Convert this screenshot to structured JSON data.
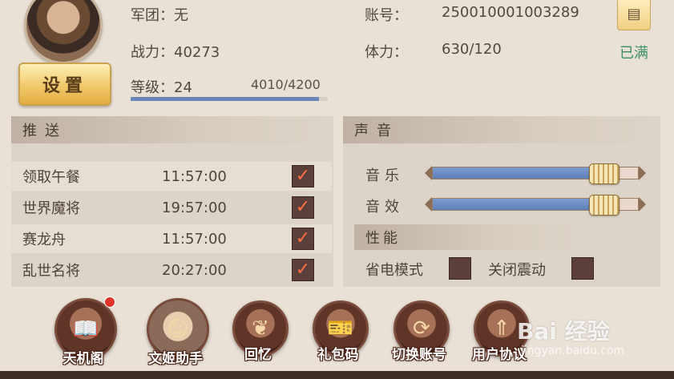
{
  "profile": {
    "legion_label": "军团：",
    "legion_value": "无",
    "power_label": "战力：",
    "power_value": "40273",
    "level_label": "等级：",
    "level_value": "24",
    "xp_text": "4010/4200",
    "xp_progress": 0.955,
    "account_label": "账号：",
    "account_value": "250010001003289",
    "stamina_label": "体力：",
    "stamina_value": "630/120",
    "stamina_status": "已满",
    "settings_label": "设置",
    "account_icon": "account-card-icon"
  },
  "push": {
    "title": "推送",
    "rows": [
      {
        "name": "领取午餐",
        "time": "11:57:00",
        "checked": true
      },
      {
        "name": "世界魔将",
        "time": "19:57:00",
        "checked": true
      },
      {
        "name": "赛龙舟",
        "time": "11:57:00",
        "checked": true
      },
      {
        "name": "乱世名将",
        "time": "20:27:00",
        "checked": true
      }
    ],
    "check_glyph": "✓"
  },
  "sound": {
    "title": "声音",
    "music_label": "音乐",
    "music_level": 0.83,
    "effects_label": "音效",
    "effects_level": 0.83
  },
  "performance": {
    "title": "性能",
    "power_save_label": "省电模式",
    "power_save_checked": false,
    "vibration_off_label": "关闭震动",
    "vibration_off_checked": false
  },
  "nav": [
    {
      "label": "天机阁",
      "icon": "book-icon",
      "badge": true
    },
    {
      "label": "文姬助手",
      "icon": "assistant-portrait-icon",
      "badge": false
    },
    {
      "label": "回忆",
      "icon": "leaf-icon",
      "badge": false
    },
    {
      "label": "礼包码",
      "icon": "ticket-icon",
      "badge": false
    },
    {
      "label": "切换账号",
      "icon": "switch-arrows-icon",
      "badge": false
    },
    {
      "label": "用户协议",
      "icon": "upload-arrows-icon",
      "badge": false
    }
  ],
  "watermark": {
    "text": "Bai 经验",
    "sub": "jingyan.baidu.com"
  },
  "colors": {
    "accent_gold": "#f1c96a",
    "status_green": "#3e8f63",
    "slider_blue": "#6b86b9",
    "check_red": "#ff6f45"
  }
}
